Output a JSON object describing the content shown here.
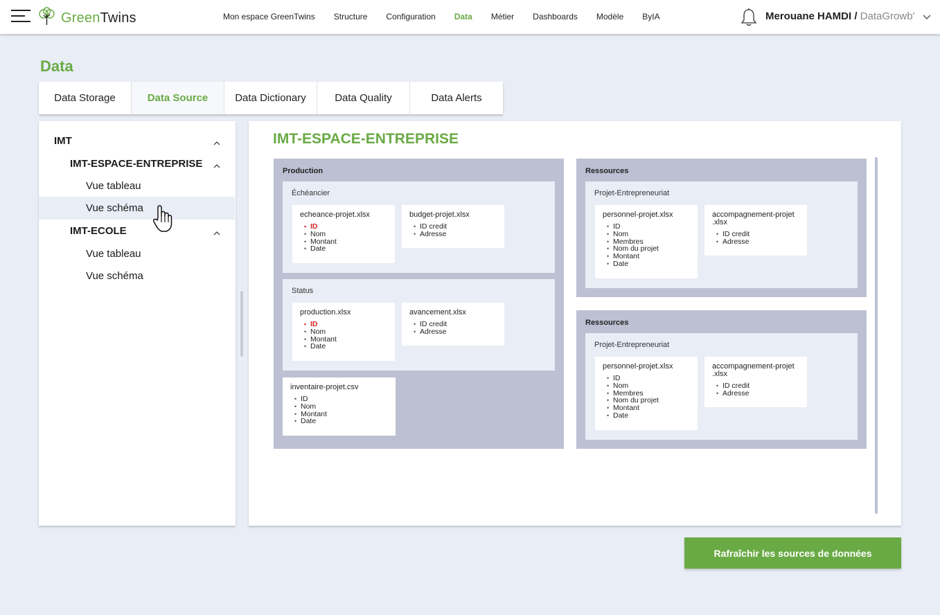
{
  "app": {
    "logo_part1": "Green",
    "logo_part2": "Twins"
  },
  "nav": {
    "items": [
      {
        "label": "Mon espace GreenTwins"
      },
      {
        "label": "Structure"
      },
      {
        "label": "Configuration"
      },
      {
        "label": "Data",
        "active": true
      },
      {
        "label": "Métier"
      },
      {
        "label": "Dashboards"
      },
      {
        "label": "Modèle"
      },
      {
        "label": "ByIA"
      }
    ]
  },
  "user": {
    "name": "Merouane HAMDI /",
    "org": " DataGrowb'"
  },
  "page": {
    "title": "Data"
  },
  "tabs": [
    {
      "label": "Data Storage"
    },
    {
      "label": "Data Source",
      "active": true
    },
    {
      "label": "Data Dictionary"
    },
    {
      "label": "Data Quality"
    },
    {
      "label": "Data Alerts"
    }
  ],
  "tree": {
    "items": [
      {
        "label": "IMT",
        "level": 0,
        "expanded": true
      },
      {
        "label": "IMT-ESPACE-ENTREPRISE",
        "level": 1,
        "expanded": true
      },
      {
        "label": "Vue tableau",
        "level": 2
      },
      {
        "label": "Vue schéma",
        "level": 2,
        "selected": true
      },
      {
        "label": "IMT-ECOLE",
        "level": 1,
        "expanded": true
      },
      {
        "label": "Vue tableau",
        "level": 2
      },
      {
        "label": "Vue schéma",
        "level": 2
      }
    ]
  },
  "schema": {
    "title": "IMT-ESPACE-ENTREPRISE",
    "production": {
      "label": "Production",
      "echeancier": {
        "label": "Échéancier",
        "files": [
          {
            "name": "echeance-projet.xlsx",
            "fields": [
              "ID",
              "Nom",
              "Montant",
              "Date"
            ]
          },
          {
            "name": "budget-projet.xlsx",
            "fields": [
              "ID credit",
              "Adresse"
            ]
          }
        ]
      },
      "status": {
        "label": "Status",
        "files": [
          {
            "name": "production.xlsx",
            "fields": [
              "ID",
              "Nom",
              "Montant",
              "Date"
            ]
          },
          {
            "name": "avancement.xlsx",
            "fields": [
              "ID credit",
              "Adresse"
            ]
          }
        ]
      },
      "loose_file": {
        "name": "inventaire-projet.csv",
        "fields": [
          "ID",
          "Nom",
          "Montant",
          "Date"
        ]
      }
    },
    "ressources": [
      {
        "label": "Ressources",
        "sub_label": "Projet-Entrepreneuriat",
        "files": [
          {
            "name": "personnel-projet.xlsx",
            "fields": [
              "ID",
              "Nom",
              "Membres",
              "Nom du projet",
              "Montant",
              "Date"
            ]
          },
          {
            "name_line1": "accompagnement-projet",
            "name_line2": ".xlsx",
            "fields": [
              "ID credit",
              "Adresse"
            ]
          }
        ]
      },
      {
        "label": "Ressources",
        "sub_label": "Projet-Entrepreneuriat",
        "files": [
          {
            "name": "personnel-projet.xlsx",
            "fields": [
              "ID",
              "Nom",
              "Membres",
              "Nom du projet",
              "Montant",
              "Date"
            ]
          },
          {
            "name_line1": "accompagnement-projet",
            "name_line2": ".xlsx",
            "fields": [
              "ID credit",
              "Adresse"
            ]
          }
        ]
      }
    ]
  },
  "actions": {
    "refresh_label": "Rafraîchir les sources de données"
  },
  "colors": {
    "accent": "#6aaa45",
    "key_field": "#d42424",
    "group_bg": "#bcc0d2",
    "sub_bg": "#e9edf5"
  },
  "icons": [
    "menu-icon",
    "logo-tree-icon",
    "bell-icon",
    "chevron-down-icon",
    "chevron-up-icon",
    "hand-cursor-icon"
  ]
}
